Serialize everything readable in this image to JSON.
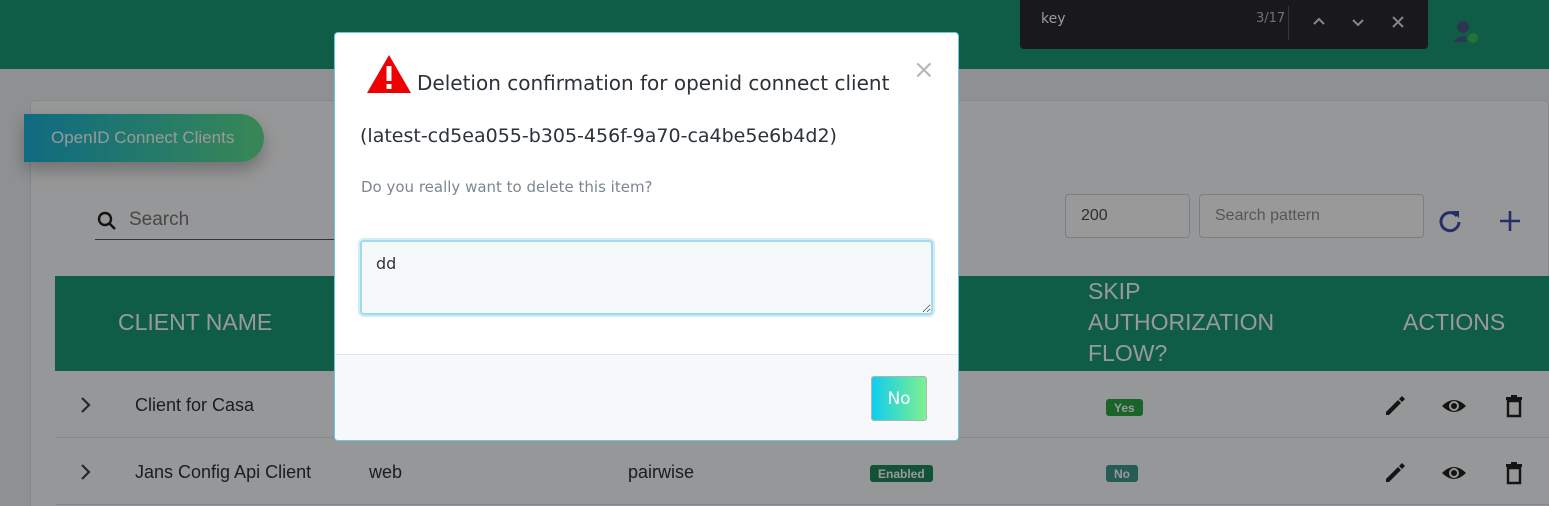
{
  "findbar": {
    "query": "key",
    "count": "3/17"
  },
  "page": {
    "section_title": "OpenID Connect Clients",
    "search_placeholder": "Search",
    "limit_value": "200",
    "pattern_placeholder": "Search pattern"
  },
  "table": {
    "headers": {
      "client_name": "CLIENT NAME",
      "skip_authorization": "SKIP AUTHORIZATION FLOW?",
      "actions": "ACTIONS"
    },
    "rows": [
      {
        "name": "Client for Casa",
        "type": "",
        "subject": "",
        "status": "",
        "skip": "Yes"
      },
      {
        "name": "Jans Config Api Client",
        "type": "web",
        "subject": "pairwise",
        "status": "Enabled",
        "skip": "No"
      }
    ]
  },
  "modal": {
    "title": "Deletion confirmation for openid connect client",
    "client_id": "(latest-cd5ea055-b305-456f-9a70-ca4be5e6b4d2)",
    "question": "Do you really want to delete this item?",
    "textarea_value": "dd",
    "close_symbol": "×",
    "no_label": "No"
  },
  "colors": {
    "header_green": "#1a9c75",
    "warning_red": "#e00000",
    "action_icon": "#222222"
  },
  "icons": [
    "search-icon",
    "refresh-icon",
    "plus-icon",
    "chevron-right-icon",
    "edit-icon",
    "eye-icon",
    "trash-icon",
    "warning-icon",
    "close-icon",
    "avatar-icon"
  ]
}
